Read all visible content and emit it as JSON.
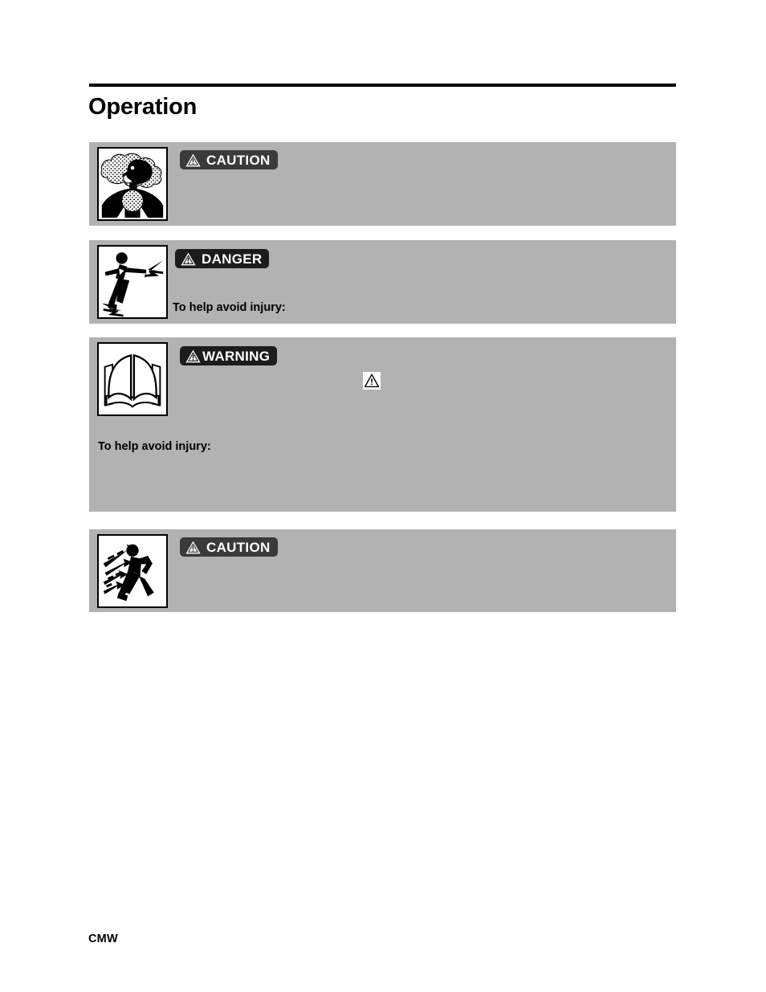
{
  "document": {
    "title": "Operation",
    "footer_label": "CMW",
    "rule_color": "#000000",
    "box_background": "#b2b2b2"
  },
  "safety_boxes": [
    {
      "signal_word": "CAUTION",
      "signal_badge_color": "#3a3a3a",
      "pictogram": "dust-inhalation-hazard-icon",
      "body_text": ""
    },
    {
      "signal_word": "DANGER",
      "signal_badge_color": "#1c1c1c",
      "pictogram": "electrocution-hazard-icon",
      "body_text": "To help avoid injury:"
    },
    {
      "signal_word": "WARNING",
      "signal_badge_color": "#1c1c1c",
      "pictogram": "read-manual-icon",
      "body_text": "To help avoid injury:",
      "alert_symbol": "safety-alert-triangle-icon"
    },
    {
      "signal_word": "CAUTION",
      "signal_badge_color": "#3a3a3a",
      "pictogram": "flying-debris-hazard-icon",
      "body_text": ""
    }
  ]
}
